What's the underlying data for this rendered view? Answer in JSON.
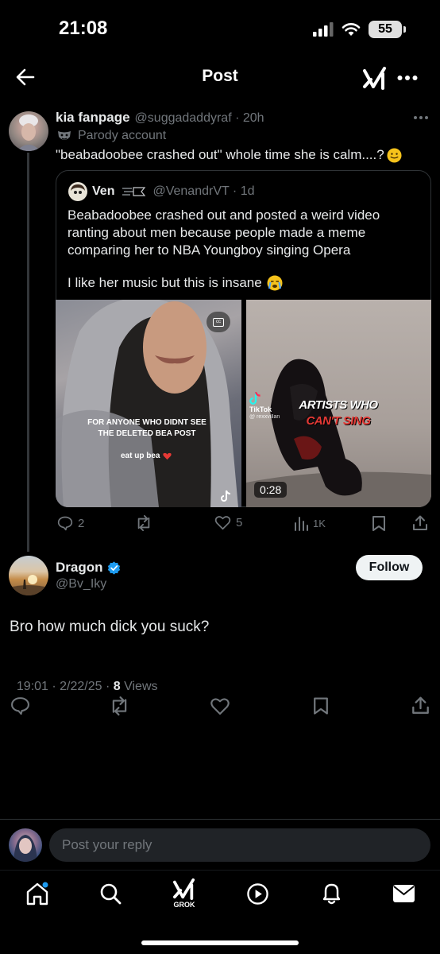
{
  "status": {
    "time": "21:08",
    "battery": "55"
  },
  "header": {
    "title": "Post"
  },
  "post": {
    "author_name": "kia fanpage",
    "handle_time": "@suggadaddyraf · 20h",
    "label": "Parody account",
    "text": "\"beabadoobee crashed out\" whole time she is calm....?",
    "quote": {
      "author_name": "Ven",
      "handle_time": "@VenandrVT · 1d",
      "text1": "Beabadoobee crashed out and posted a weird video ranting about men because people made a meme comparing her to NBA Youngboy singing Opera",
      "text2": "I like her music but this is insane",
      "media_left_caption1": "FOR ANYONE WHO DIDNT SEE",
      "media_left_caption2": "THE DELETED BEA POST",
      "media_left_caption3": "eat up bea",
      "media_right_title1": "ARTISTS WHO",
      "media_right_title2": "CAN'T SING",
      "media_right_tiktok": "TikTok",
      "media_right_user": "@ rexxvillan",
      "video_duration": "0:28"
    },
    "stats": {
      "replies": "2",
      "likes": "5",
      "views": "1K"
    }
  },
  "reply": {
    "author_name": "Dragon",
    "handle": "@Bv_Iky",
    "follow_label": "Follow",
    "text": "Bro how much dick you suck?",
    "time": "19:01 · 2/22/25 · ",
    "views_count": "8",
    "views_label": " Views"
  },
  "compose": {
    "placeholder": "Post your reply"
  },
  "tabbar": {
    "grok_label": "GROK"
  }
}
